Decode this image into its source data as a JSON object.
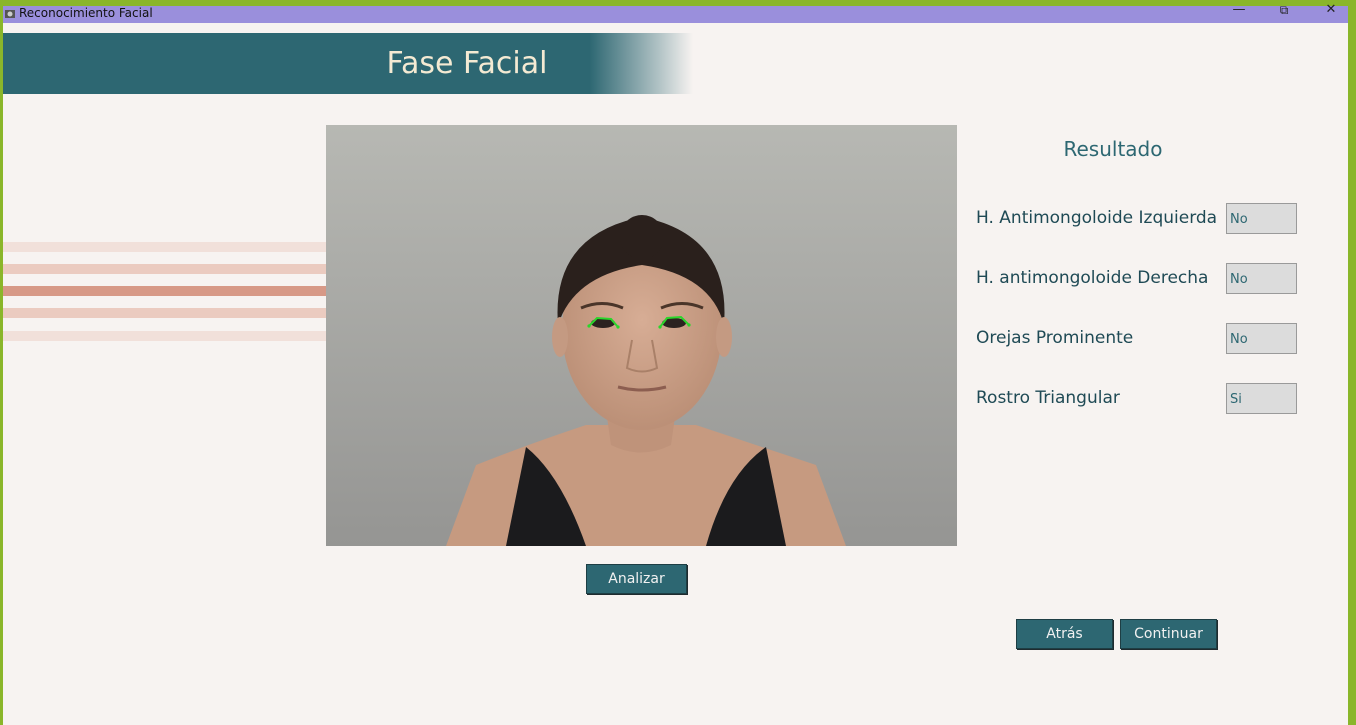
{
  "window": {
    "title": "Reconocimiento Facial",
    "controls": {
      "minimize": "—",
      "restore": "⧉",
      "close": "✕"
    }
  },
  "header": {
    "title": "Fase Facial"
  },
  "results": {
    "heading": "Resultado",
    "rows": [
      {
        "label": "H. Antimongoloide Izquierda",
        "value": "No"
      },
      {
        "label": "H. antimongoloide Derecha",
        "value": "No"
      },
      {
        "label": "Orejas Prominente",
        "value": "No"
      },
      {
        "label": "Rostro Triangular",
        "value": "Si"
      }
    ]
  },
  "buttons": {
    "analyze": "Analizar",
    "back": "Atrás",
    "continue": "Continuar"
  },
  "colors": {
    "accent": "#2d6772",
    "title_text": "#f4ead3",
    "background": "#f7f3f1",
    "titlebar": "#9a8fdc",
    "frame": "#8ab62a",
    "landmarks": "#2bd62b"
  }
}
